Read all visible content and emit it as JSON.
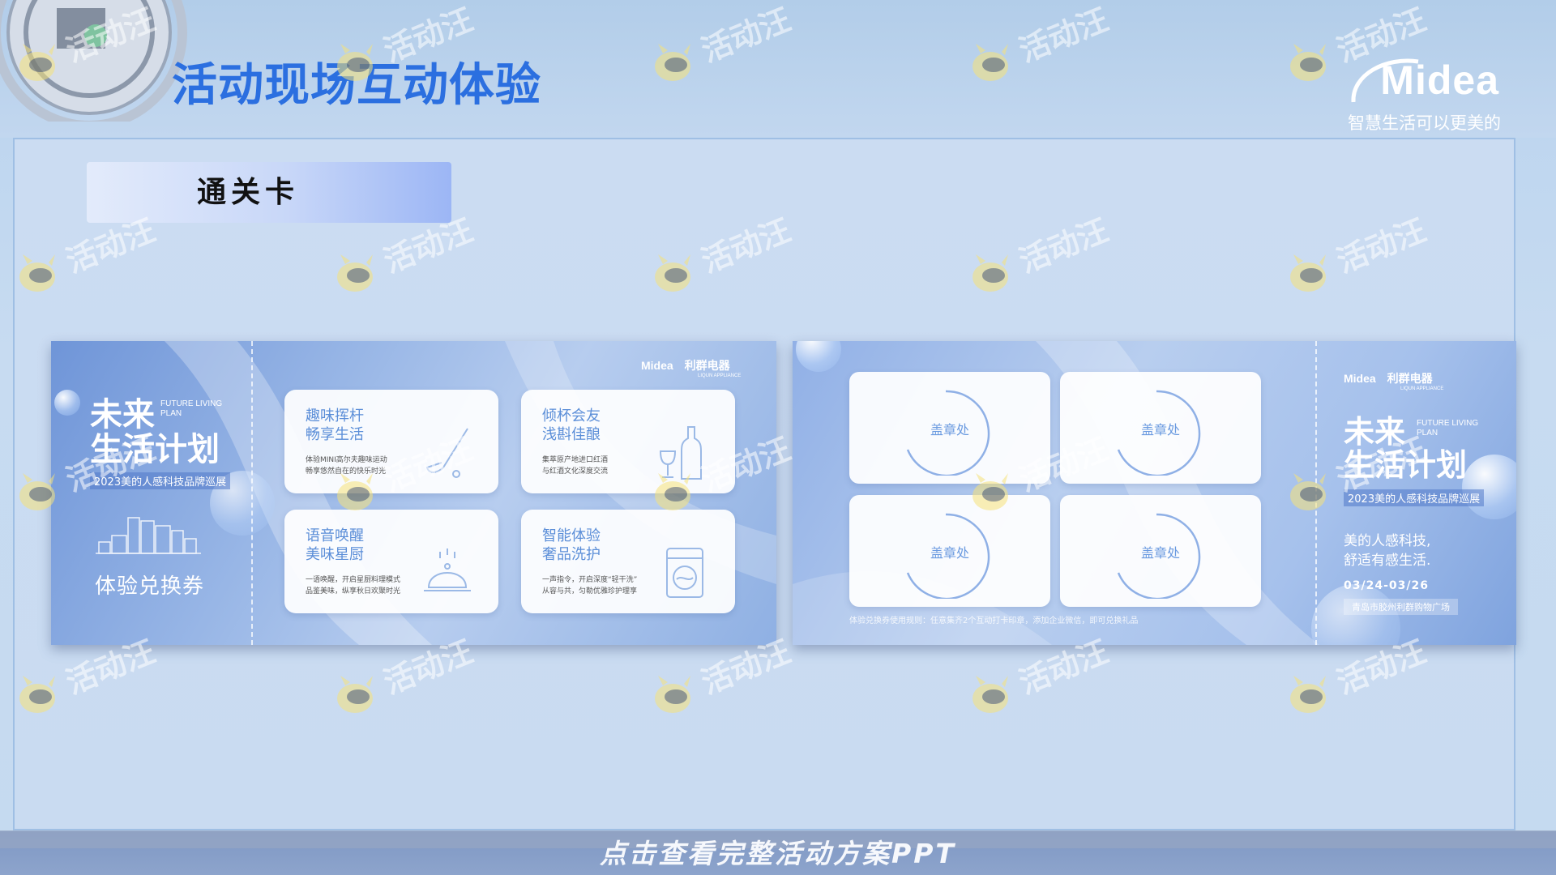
{
  "header": {
    "title": "活动现场互动体验",
    "brand_name": "Midea",
    "brand_slogan": "智慧生活可以更美的"
  },
  "section": {
    "label": "通关卡"
  },
  "left_card": {
    "logo_brand": "Midea",
    "logo_partner": "利群电器",
    "logo_partner_en": "LIQUN APPLIANCE",
    "title_line1": "未来",
    "title_line2": "生活计划",
    "en_line1": "FUTURE LIVING",
    "en_line2": "PLAN",
    "year_tag": "2023美的人感科技品牌巡展",
    "voucher": "体验兑换券",
    "tiles": [
      {
        "title_line1": "趣味挥杆",
        "title_line2": "畅享生活",
        "desc_line1": "体验MINI高尔夫趣味运动",
        "desc_line2": "畅享悠然自在的快乐时光",
        "icon": "golf-club-icon"
      },
      {
        "title_line1": "倾杯会友",
        "title_line2": "浅斟佳酿",
        "desc_line1": "集萃原产地进口红酒",
        "desc_line2": "与红酒文化深度交流",
        "icon": "wine-bottle-icon"
      },
      {
        "title_line1": "语音唤醒",
        "title_line2": "美味星厨",
        "desc_line1": "一语唤醒，开启星厨料理模式",
        "desc_line2": "品鉴美味，纵享秋日欢聚时光",
        "icon": "cloche-icon"
      },
      {
        "title_line1": "智能体验",
        "title_line2": "奢品洗护",
        "desc_line1": "一声指令，开启深度“轻干洗”",
        "desc_line2": "从容与共，匀勒优雅珍护理享",
        "icon": "washing-machine-icon"
      }
    ]
  },
  "right_card": {
    "logo_brand": "Midea",
    "logo_partner": "利群电器",
    "logo_partner_en": "LIQUN APPLIANCE",
    "title_line1": "未来",
    "title_line2": "生活计划",
    "en_line1": "FUTURE LIVING",
    "en_line2": "PLAN",
    "year_tag": "2023美的人感科技品牌巡展",
    "stamps": [
      "盖章处",
      "盖章处",
      "盖章处",
      "盖章处"
    ],
    "rules": "体验兑换券使用规则：任意集齐2个互动打卡印章，添加企业微信，即可兑换礼品",
    "tagline_line1": "美的人感科技,",
    "tagline_line2": "舒适有感生活.",
    "date": "03/24-03/26",
    "venue": "青岛市胶州利群购物广场"
  },
  "watermark": {
    "text": "活动汪"
  },
  "cta": {
    "label": "点击查看完整活动方案PPT"
  },
  "colors": {
    "title_blue": "#2b6fe0",
    "accent_blue": "#5b8ed8",
    "background": "#c5daf0"
  }
}
